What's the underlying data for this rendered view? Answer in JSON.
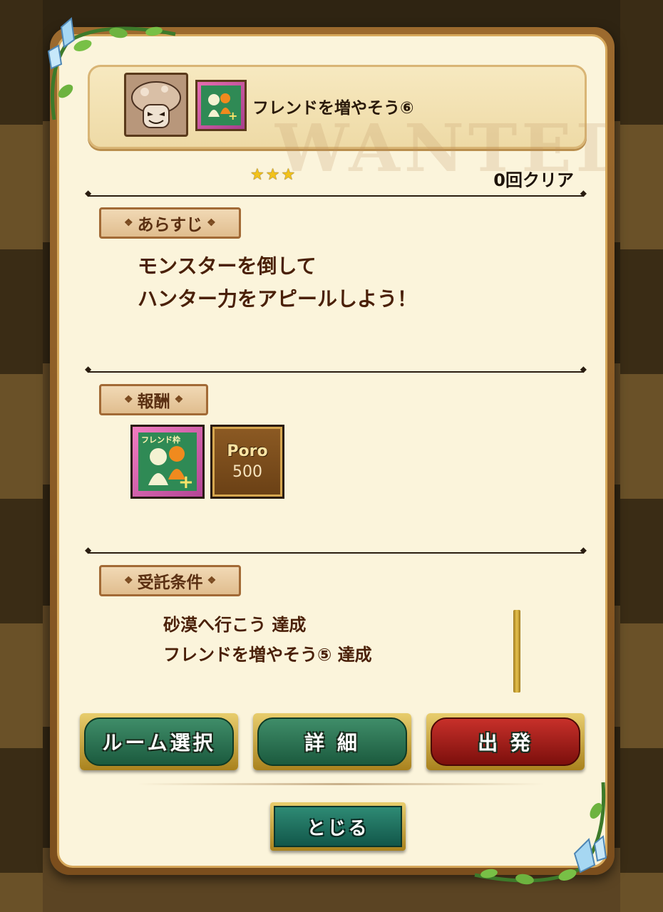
{
  "header": {
    "title": "フレンドを増やそう⑥",
    "friend_icon_label": "フレンド枠"
  },
  "watermark": "WANTED",
  "rating": {
    "stars": "★★★",
    "value": 3,
    "max": 3
  },
  "clear_count": "0回クリア",
  "sections": {
    "story": {
      "title": "あらすじ",
      "lines": [
        "モンスターを倒して",
        "ハンター力をアピールしよう！"
      ]
    },
    "reward": {
      "title": "報酬",
      "items": [
        {
          "label": "フレンド枠"
        },
        {
          "label": "Poro",
          "amount": "500"
        }
      ]
    },
    "conditions": {
      "title": "受託条件",
      "lines": [
        "砂漠へ行こう 達成",
        "フレンドを増やそう⑤ 達成"
      ]
    }
  },
  "buttons": {
    "room_select": "ルーム選択",
    "details": "詳 細",
    "depart": "出 発",
    "close": "とじる"
  },
  "colors": {
    "panel": "#fbf4db",
    "frame": "#9c6a2e",
    "green_button": "#1b5a3e",
    "red_button": "#7c0f0c",
    "text": "#4a2008"
  }
}
